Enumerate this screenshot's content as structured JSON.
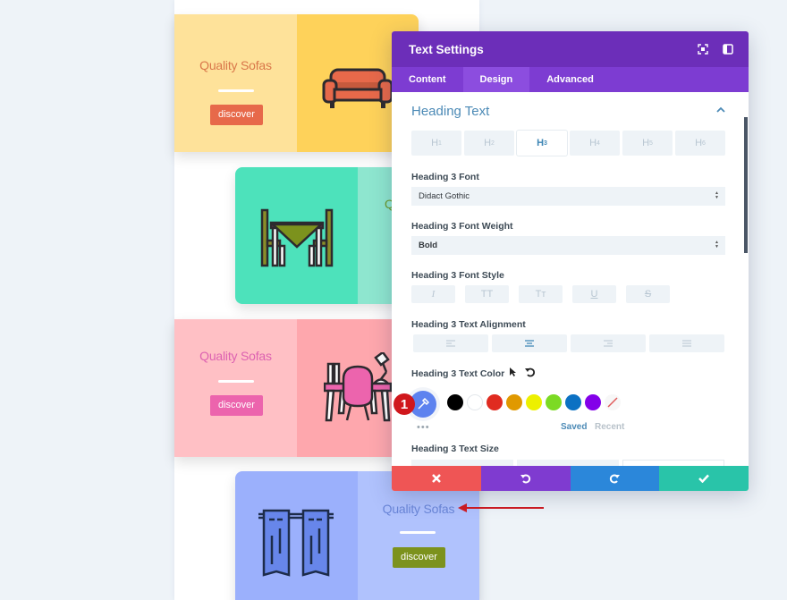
{
  "cards": [
    {
      "title": "Quality Sofas",
      "button": "discover",
      "icon": "sofa-icon"
    },
    {
      "title": "Q",
      "icon": "dining-table-icon"
    },
    {
      "title": "Quality Sofas",
      "button": "discover",
      "icon": "desk-chair-icon"
    },
    {
      "title": "Quality Sofas",
      "button": "discover",
      "icon": "curtains-icon"
    }
  ],
  "modal": {
    "title": "Text Settings",
    "tabs": [
      {
        "label": "Content",
        "active": false
      },
      {
        "label": "Design",
        "active": true
      },
      {
        "label": "Advanced",
        "active": false
      }
    ],
    "section_title": "Heading Text",
    "heading_levels": [
      {
        "label": "H",
        "sub": "1"
      },
      {
        "label": "H",
        "sub": "2"
      },
      {
        "label": "H",
        "sub": "3",
        "active": true
      },
      {
        "label": "H",
        "sub": "4"
      },
      {
        "label": "H",
        "sub": "5"
      },
      {
        "label": "H",
        "sub": "6"
      }
    ],
    "font_label": "Heading 3 Font",
    "font_value": "Didact Gothic",
    "weight_label": "Heading 3 Font Weight",
    "weight_value": "Bold",
    "style_label": "Heading 3 Font Style",
    "style_options": [
      "I",
      "TT",
      "Tт",
      "U",
      "S"
    ],
    "align_label": "Heading 3 Text Alignment",
    "align_options": [
      "left",
      "center",
      "right",
      "justify"
    ],
    "align_selected": "center",
    "color_label": "Heading 3 Text Color",
    "badge": "1",
    "swatches": [
      "#000000",
      "#ffffff",
      "#e02b20",
      "#e09900",
      "#edf000",
      "#7cda24",
      "#0c71c3",
      "#8300e9"
    ],
    "saved_label": "Saved",
    "recent_label": "Recent",
    "more_label": "•••",
    "size_label": "Heading 3 Text Size"
  }
}
